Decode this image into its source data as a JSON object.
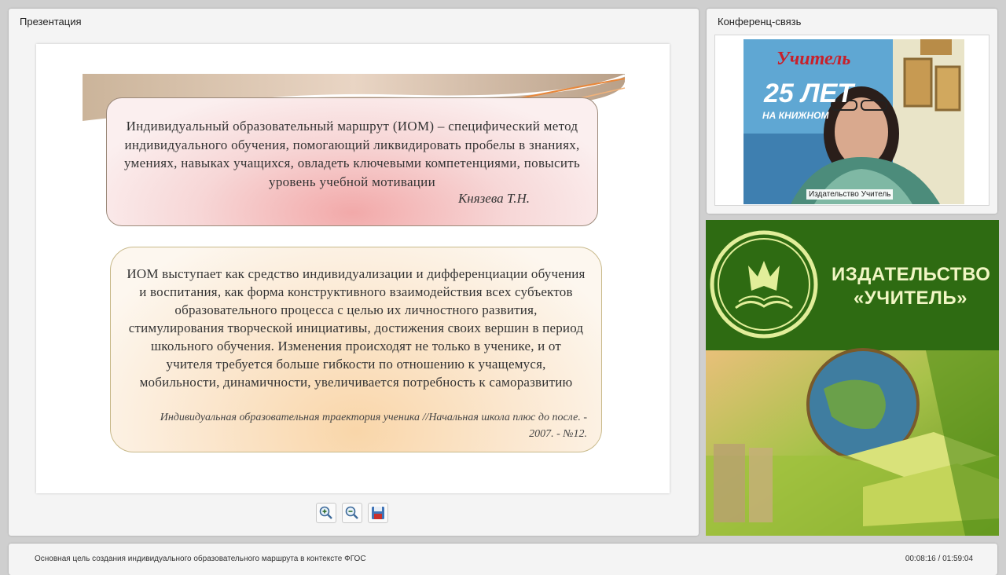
{
  "presentation_panel": {
    "title": "Презентация",
    "slide": {
      "box1_text": "Индивидуальный образовательный маршрут (ИОМ) – специфический метод индивидуального обучения, помогающий ликвидировать пробелы в знаниях, умениях, навыках учащихся, овладеть ключевыми компетенциями, повысить уровень учебной мотивации",
      "box1_author": "Князева Т.Н.",
      "box2_text": "ИОМ выступает как средство индивидуализации и дифференциации обучения и воспитания, как форма конструктивного взаимодействия всех субъектов образовательного процесса с целью их личностного развития, стимулирования творческой инициативы, достижения своих вершин в период школьного обучения. Изменения происходят не только в ученике, и от учителя требуется больше гибкости по отношению к учащемуся, мобильности, динамичности, увеличивается потребность к саморазвитию",
      "box2_citation": "Индивидуальная образовательная траектория ученика //Начальная школа плюс до после. - 2007. - №12."
    },
    "toolbar": {
      "zoom_in_icon": "zoom-in-icon",
      "zoom_out_icon": "zoom-out-icon",
      "save_icon": "floppy-disk-icon"
    }
  },
  "conference_panel": {
    "title": "Конференц-связь",
    "video_label": "Издательство Учитель",
    "banner_text": "Учитель",
    "banner_big": "25 ЛЕТ",
    "banner_sub": "НА КНИЖНОМ"
  },
  "publisher_panel": {
    "name_line1": "ИЗДАТЕЛЬСТВО",
    "name_line2": "«УЧИТЕЛЬ»",
    "brand_green": "#2e6b12"
  },
  "footer": {
    "title": "Основная цель создания индивидуального образовательного маршрута в контексте ФГОС",
    "time": "00:08:16 / 01:59:04"
  }
}
